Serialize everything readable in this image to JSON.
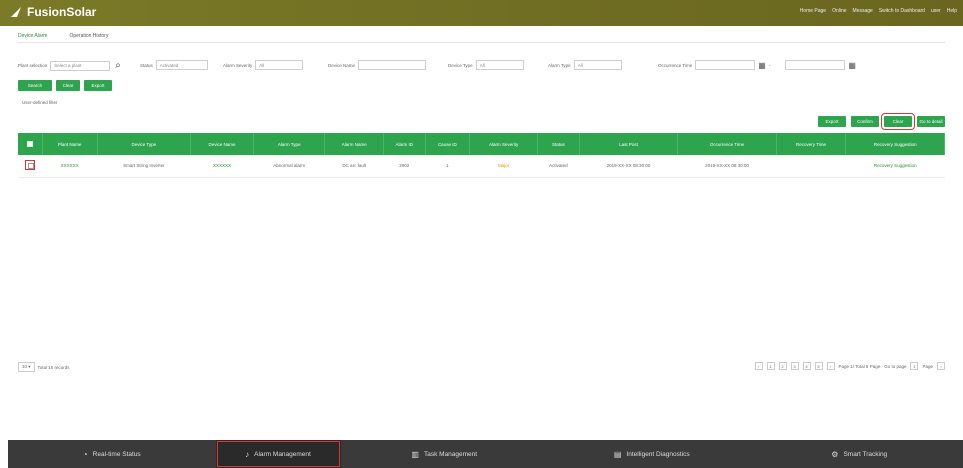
{
  "header": {
    "brand": "FusionSolar",
    "links": [
      "Home Page",
      "Online",
      "Message",
      "Switch to Dashboard",
      "user",
      "Help"
    ]
  },
  "tabs": [
    {
      "label": "Device Alarm",
      "active": true
    },
    {
      "label": "Operation History",
      "active": false
    }
  ],
  "filters": {
    "plant": {
      "label": "Plant selection",
      "value": "Select a plant"
    },
    "status": {
      "label": "Status",
      "value": "Activated"
    },
    "severity": {
      "label": "Alarm Severity",
      "value": "All"
    },
    "device": {
      "label": "Device Name",
      "value": ""
    },
    "device_type": {
      "label": "Device Type",
      "value": "All"
    },
    "alarm_type": {
      "label": "Alarm Type",
      "value": "All"
    },
    "occurrence": {
      "label": "Occurrence Time",
      "start": "",
      "end": ""
    }
  },
  "actions": {
    "search": "Search",
    "clear": "Clear",
    "export": "Export",
    "udf": "User-defined filter"
  },
  "table_actions": [
    "Export",
    "Confirm",
    "Clear",
    "Go to detail"
  ],
  "table": {
    "columns": [
      "Plant Name",
      "Device Type",
      "Device Name",
      "Alarm Type",
      "Alarm Name",
      "Alarm ID",
      "Cause ID",
      "Alarm Severity",
      "Status",
      "Last Post",
      "Occurrence Time",
      "Recovery Time",
      "Recovery Suggestion"
    ],
    "rows": [
      [
        "XXXXXX",
        "Smart String Inverter",
        "XXXXXX",
        "Abnormal alarm",
        "DC arc fault",
        "2002",
        "1",
        "Major",
        "Activated",
        "2019-XX-XX 08:30:00",
        "2019-XX-XX 08:30:00",
        "",
        "Recovery Suggestion"
      ]
    ]
  },
  "pagination": {
    "per_page": "10",
    "total": "Total 10 records",
    "pages": [
      "1",
      "2",
      "3",
      "4",
      "5"
    ],
    "right_text": "Page 1/ Total 5 Page",
    "goto": "Go to page",
    "page_input": "1",
    "page_unit": "Page"
  },
  "bottom_nav": [
    {
      "label": "Real-time Status",
      "icon": "clock-icon"
    },
    {
      "label": "Alarm Management",
      "icon": "bell-icon",
      "active": true
    },
    {
      "label": "Task Management",
      "icon": "chart-icon"
    },
    {
      "label": "Intelligent Diagnostics",
      "icon": "doc-icon"
    },
    {
      "label": "Smart Tracking",
      "icon": "gear-icon"
    }
  ]
}
